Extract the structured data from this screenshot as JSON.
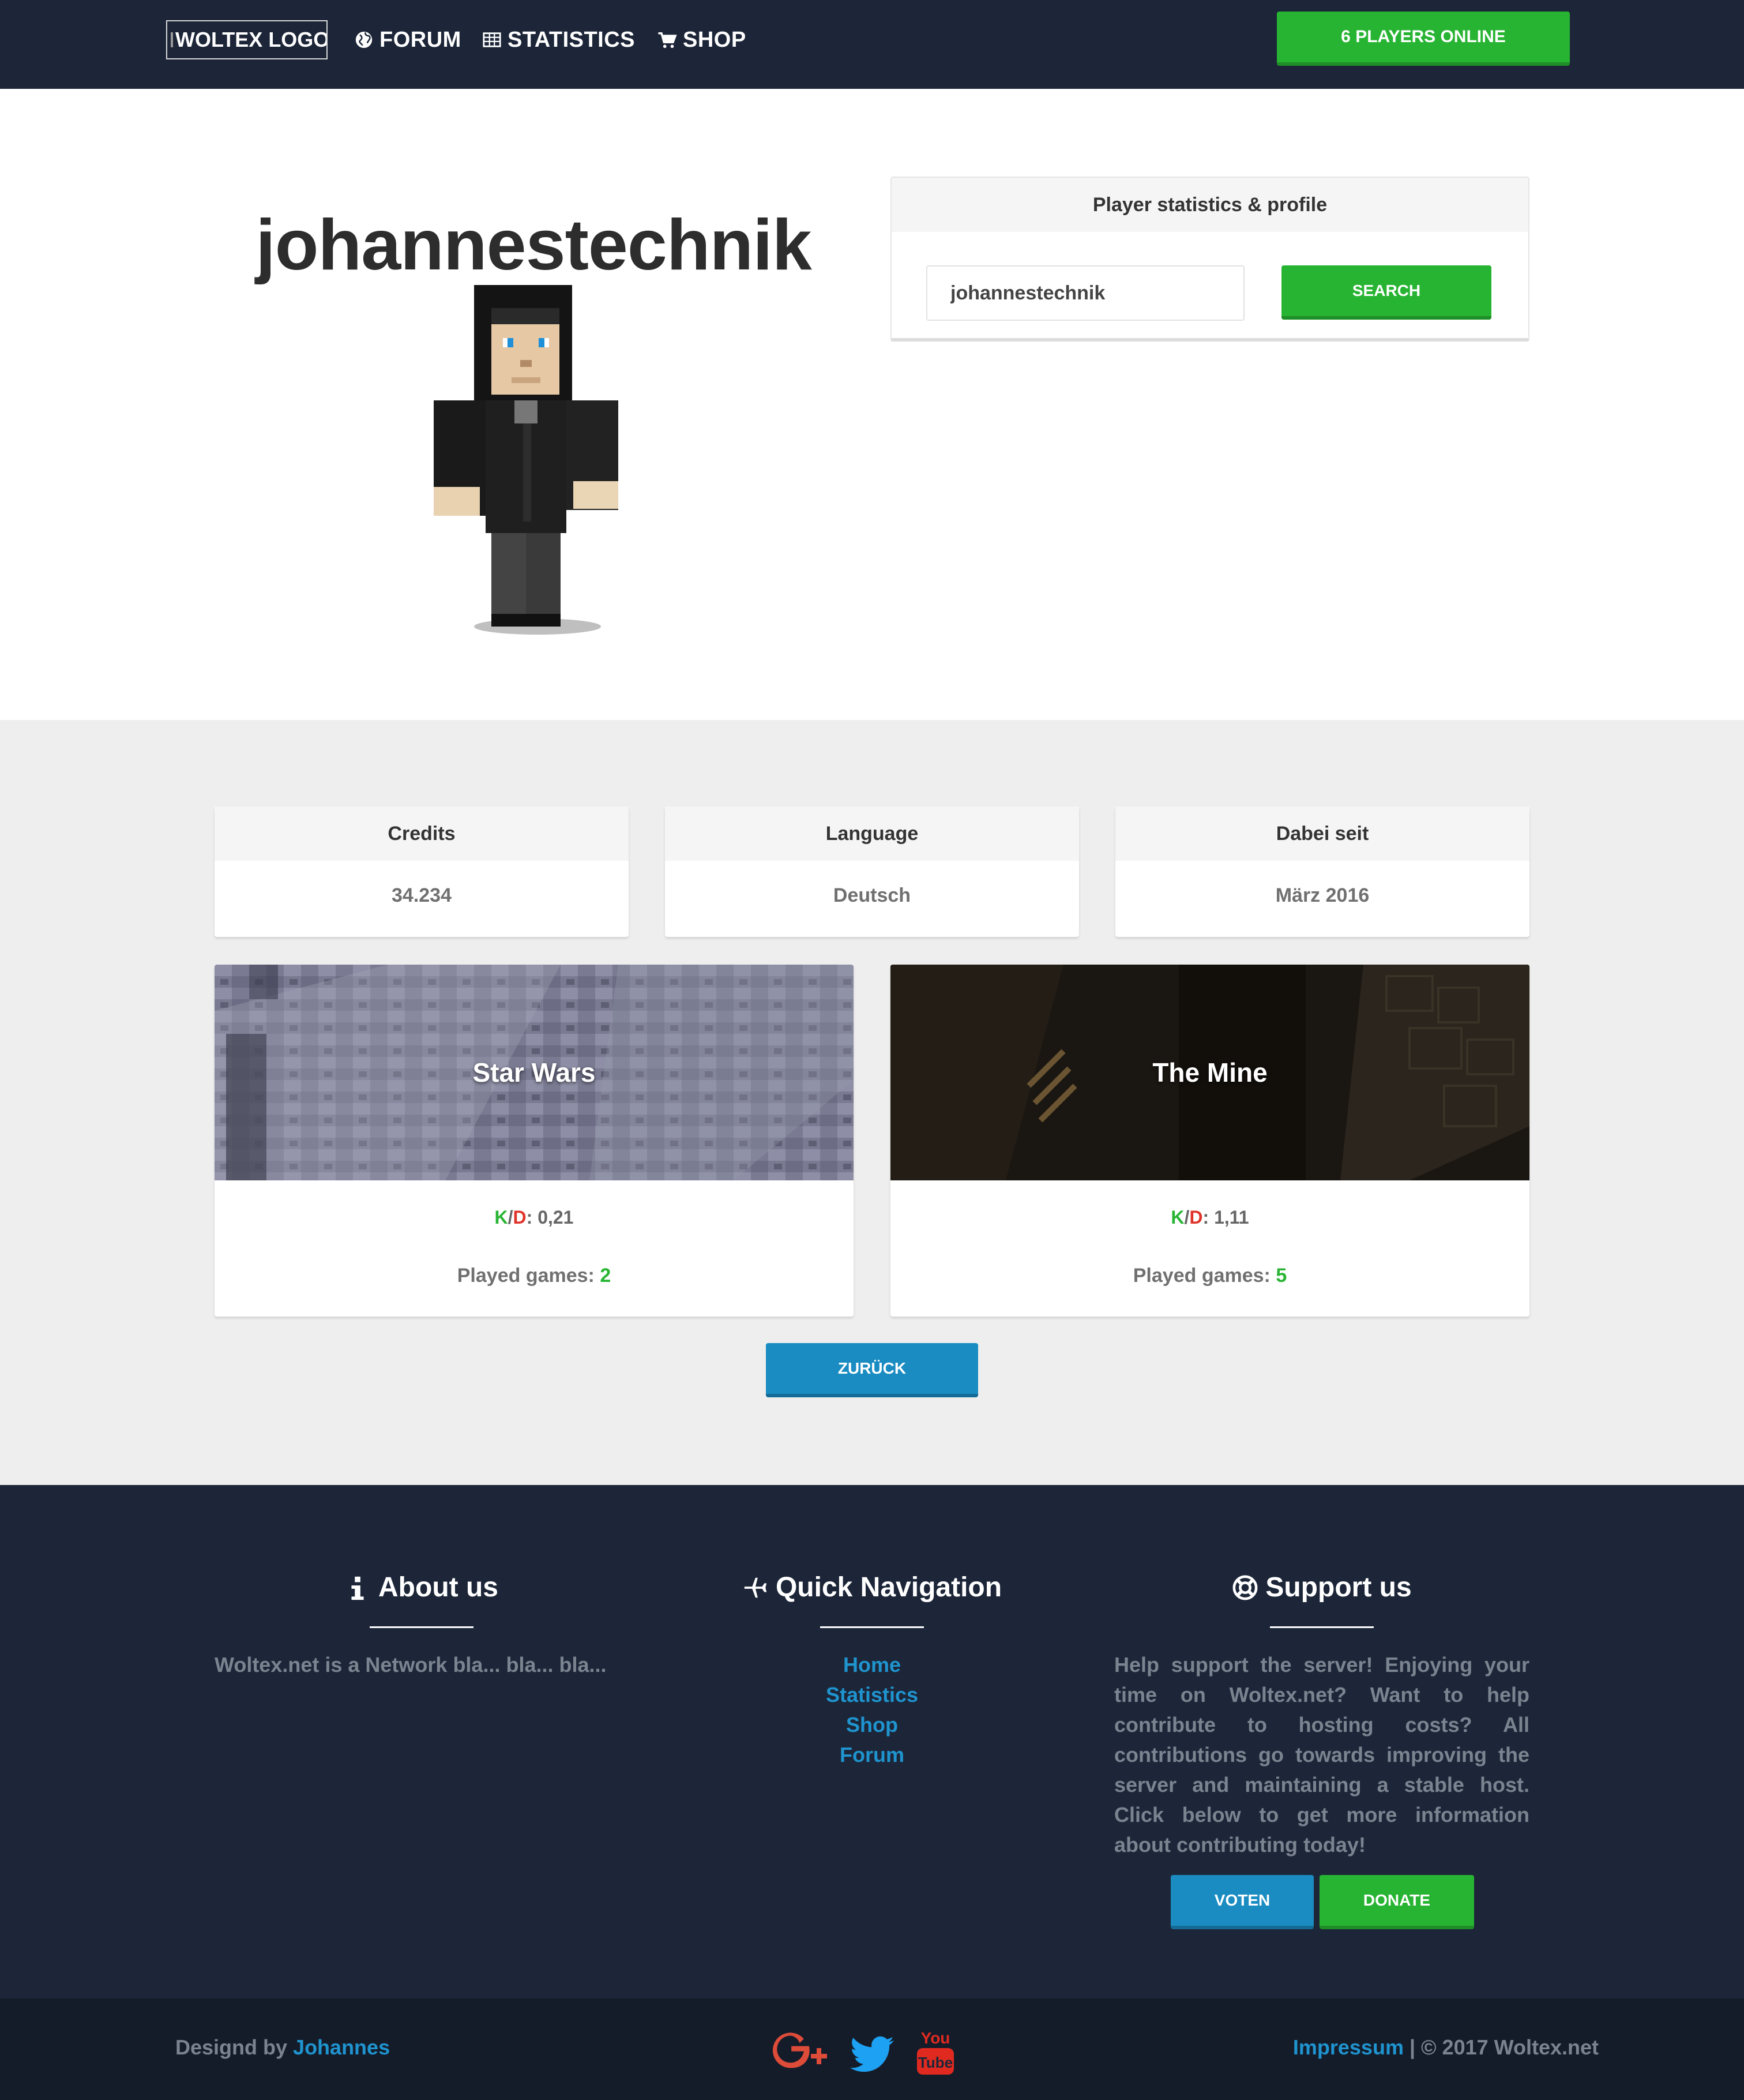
{
  "nav": {
    "logo_alt": "WOLTEX LOGO",
    "items": [
      {
        "label": "FORUM",
        "icon": "globe-icon"
      },
      {
        "label": "STATISTICS",
        "icon": "table-icon"
      },
      {
        "label": "SHOP",
        "icon": "cart-icon"
      }
    ],
    "players_online": "6 PLAYERS ONLINE"
  },
  "profile": {
    "name": "johannestechnik",
    "search_card_title": "Player statistics & profile",
    "search_value": "johannestechnik",
    "search_button": "SEARCH"
  },
  "info": [
    {
      "label": "Credits",
      "value": "34.234"
    },
    {
      "label": "Language",
      "value": "Deutsch"
    },
    {
      "label": "Dabei seit",
      "value": "März 2016"
    }
  ],
  "games": [
    {
      "title": "Star Wars",
      "kd_k": "K",
      "kd_slash": "/",
      "kd_d": "D",
      "kd_sep": ":",
      "kd_value": "0,21",
      "played_label": "Played games:",
      "played_value": "2"
    },
    {
      "title": "The Mine",
      "kd_k": "K",
      "kd_slash": "/",
      "kd_d": "D",
      "kd_sep": ":",
      "kd_value": "1,11",
      "played_label": "Played games:",
      "played_value": "5"
    }
  ],
  "back_button": "ZURÜCK",
  "footer": {
    "about": {
      "title": "About us",
      "icon": "info-icon",
      "text": "Woltex.net is a Network bla... bla... bla..."
    },
    "nav": {
      "title": "Quick Navigation",
      "icon": "plane-icon",
      "links": [
        "Home",
        "Statistics",
        "Shop",
        "Forum"
      ]
    },
    "support": {
      "title": "Support us",
      "icon": "lifebuoy-icon",
      "text": "Help support the server! Enjoying your time on Woltex.net? Want to help contribute to hosting costs? All contributions go towards improving the server and maintaining a stable host. Click below to get more information about contributing today!",
      "vote_button": "VOTEN",
      "donate_button": "DONATE"
    }
  },
  "bottom": {
    "credit_prefix": "Designd by",
    "credit_name": "Johannes",
    "social": [
      "google-plus-icon",
      "twitter-icon",
      "youtube-icon"
    ],
    "youtube_you": "You",
    "youtube_tube": "Tube",
    "impressum": "Impressum",
    "copyright": " | © 2017 Woltex.net"
  },
  "colors": {
    "nav_bg": "#1c2638",
    "green": "#28b433",
    "blue": "#1a8cc2",
    "link_blue": "#1f94cf",
    "red": "#e0342b"
  }
}
